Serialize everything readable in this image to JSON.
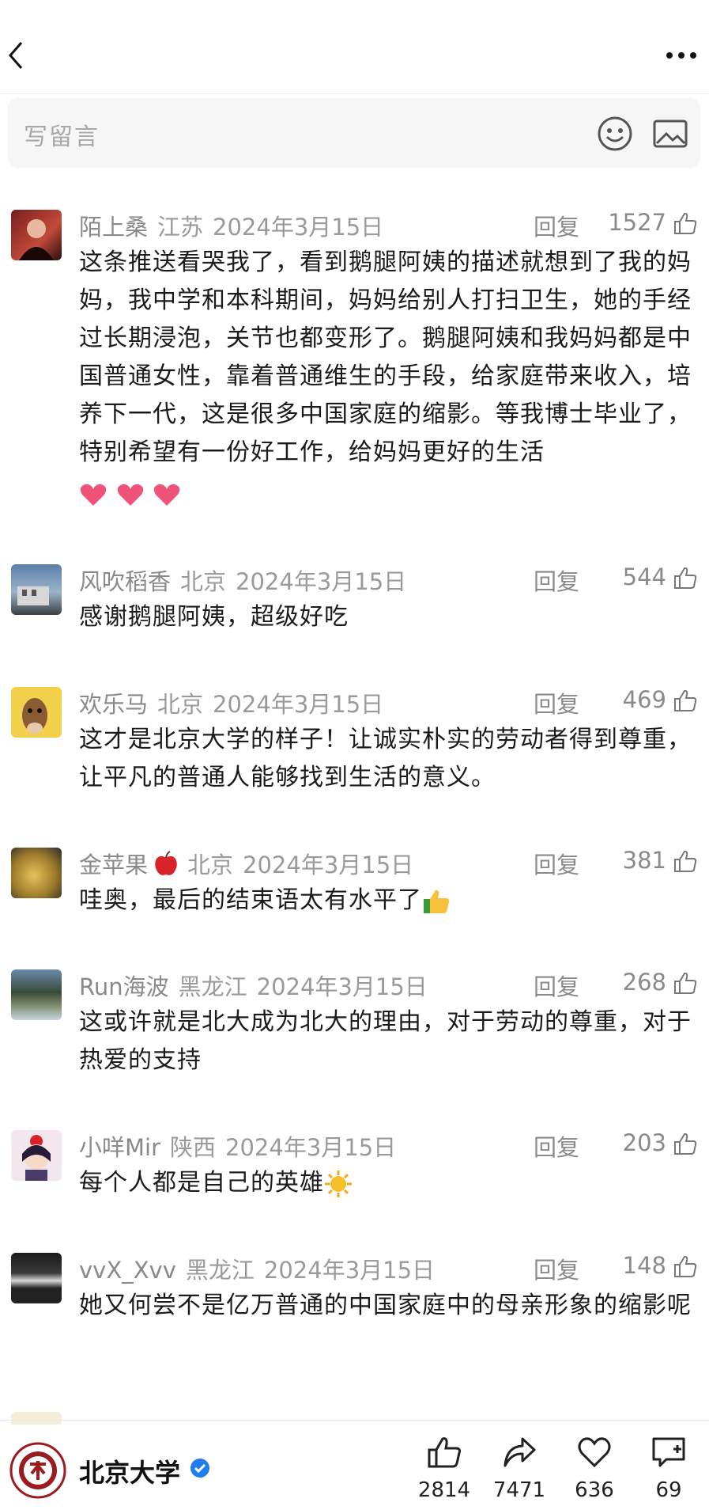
{
  "input": {
    "placeholder": "写留言"
  },
  "comments": [
    {
      "name": "陌上桑",
      "location": "江苏",
      "date": "2024年3月15日",
      "reply": "回复",
      "likes": "1527",
      "text": "这条推送看哭我了，看到鹅腿阿姨的描述就想到了我的妈妈，我中学和本科期间，妈妈给别人打扫卫生，她的手经过长期浸泡，关节也都变形了。鹅腿阿姨和我妈妈都是中国普通女性，靠着普通维生的手段，给家庭带来收入，培养下一代，这是很多中国家庭的缩影。等我博士毕业了，特别希望有一份好工作，给妈妈更好的生活"
    },
    {
      "name": "风吹稻香",
      "location": "北京",
      "date": "2024年3月15日",
      "reply": "回复",
      "likes": "544",
      "text": "感谢鹅腿阿姨，超级好吃"
    },
    {
      "name": "欢乐马",
      "location": "北京",
      "date": "2024年3月15日",
      "reply": "回复",
      "likes": "469",
      "text": "这才是北京大学的样子！让诚实朴实的劳动者得到尊重，让平凡的普通人能够找到生活的意义。"
    },
    {
      "name": "金苹果",
      "location": "北京",
      "date": "2024年3月15日",
      "reply": "回复",
      "likes": "381",
      "text": "哇奥，最后的结束语太有水平了"
    },
    {
      "name": "Run海波",
      "location": "黑龙江",
      "date": "2024年3月15日",
      "reply": "回复",
      "likes": "268",
      "text": "这或许就是北大成为北大的理由，对于劳动的尊重，对于热爱的支持"
    },
    {
      "name": "小咩Mir",
      "location": "陕西",
      "date": "2024年3月15日",
      "reply": "回复",
      "likes": "203",
      "text": "每个人都是自己的英雄"
    },
    {
      "name": "vvX_Xvv",
      "location": "黑龙江",
      "date": "2024年3月15日",
      "reply": "回复",
      "likes": "148",
      "text": "她又何尝不是亿万普通的中国家庭中的母亲形象的缩影呢"
    }
  ],
  "account": {
    "name": "北京大学"
  },
  "actions": {
    "like": "2814",
    "share": "7471",
    "favorite": "636",
    "comment": "69"
  },
  "colors": {
    "verified": "#1e7ef0",
    "heart": "#f0537a",
    "text": "#1b1b1b",
    "meta": "#9a9a9a"
  }
}
